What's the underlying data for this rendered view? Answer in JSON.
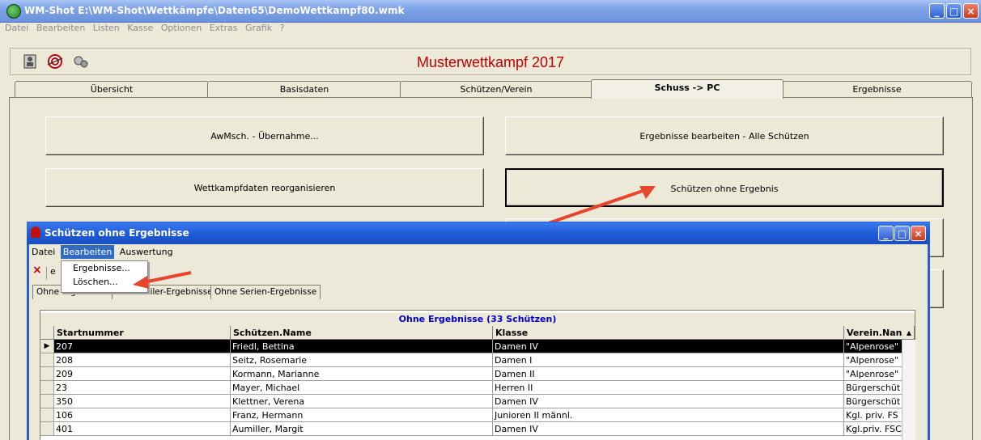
{
  "window": {
    "title": "WM-Shot E:\\WM-Shot\\Wettkämpfe\\Daten65\\DemoWettkampf80.wmk",
    "controls": {
      "minimize": "_",
      "maximize": "□",
      "close": "×"
    }
  },
  "menu": [
    "Datei",
    "Bearbeiten",
    "Listen",
    "Kasse",
    "Optionen",
    "Extras",
    "Grafik",
    "?"
  ],
  "banner": "Musterwettkampf 2017",
  "toolbar_icons": [
    "shooter-icon",
    "target-icon",
    "gears-icon"
  ],
  "tabs": [
    "Übersicht",
    "Basisdaten",
    "Schützen/Verein",
    "Schuss -> PC",
    "Ergebnisse"
  ],
  "active_tab": "Schuss -> PC",
  "buttons": {
    "awmsch": "AwMsch. - Übernahme...",
    "edit_all": "Ergebnisse bearbeiten - Alle Schützen",
    "reorganize": "Wettkampfdaten reorganisieren",
    "no_result": "Schützen ohne Ergebnis"
  },
  "dialog": {
    "title": "Schützen ohne Ergebnisse",
    "menu": [
      "Datei",
      "Bearbeiten",
      "Auswertung"
    ],
    "menu_selected": "Bearbeiten",
    "dropdown": [
      "Ergebnisse...",
      "Löschen..."
    ],
    "toolbar_close": "×",
    "toolbar_letter": "e",
    "subtabs": [
      "Ohne Ergebnisse",
      "Ohne Teiler-Ergebnisse",
      "Ohne Serien-Ergebnisse"
    ],
    "grid_caption": "Ohne Ergebnisse (33 Schützen)",
    "columns": [
      "Startnummer",
      "Schützen.Name",
      "Klasse",
      "Verein.Nan"
    ],
    "rows": [
      [
        "207",
        "Friedl, Bettina",
        "Damen IV",
        "\"Alpenrose\""
      ],
      [
        "208",
        "Seitz, Rosemarie",
        "Damen I",
        "\"Alpenrose\""
      ],
      [
        "209",
        "Kormann, Marianne",
        "Damen II",
        "\"Alpenrose\""
      ],
      [
        "23",
        "Mayer, Michael",
        "Herren II",
        "Bürgerschüt"
      ],
      [
        "350",
        "Klettner, Verena",
        "Damen IV",
        "Bürgerschüt"
      ],
      [
        "106",
        "Franz, Hermann",
        "Junioren II männl.",
        "Kgl. priv. FS"
      ],
      [
        "401",
        "Aumiller, Margit",
        "Damen IV",
        "Kgl.priv. FSC"
      ]
    ]
  },
  "colors": {
    "accent_red": "#c00000",
    "xp_blue": "#2a5bd6",
    "arrow": "#e8452c"
  }
}
